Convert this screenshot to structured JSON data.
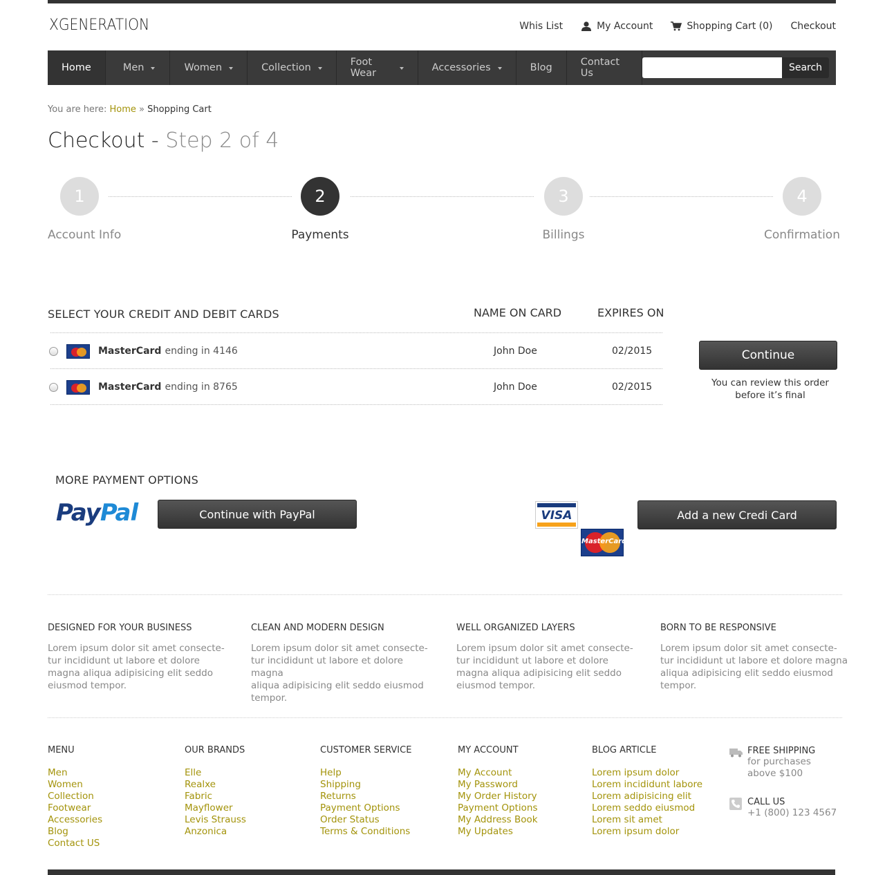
{
  "brand": {
    "logo": "XGENERATION"
  },
  "toplinks": {
    "wishlist": "Whis List",
    "account": "My Account",
    "cart": "Shopping Cart (0)",
    "checkout": "Checkout"
  },
  "nav": {
    "items": [
      "Home",
      "Men",
      "Women",
      "Collection",
      "Foot Wear",
      "Accessories",
      "Blog",
      "Contact Us"
    ],
    "search_placeholder": "",
    "search_button": "Search"
  },
  "breadcrumb": {
    "prefix": "You are here:",
    "home": "Home",
    "sep": "»",
    "current": "Shopping Cart"
  },
  "page": {
    "title": "Checkout",
    "dash": "-",
    "step_text": "Step 2 of 4"
  },
  "steps": [
    {
      "num": "1",
      "label": "Account Info"
    },
    {
      "num": "2",
      "label": "Payments"
    },
    {
      "num": "3",
      "label": "Billings"
    },
    {
      "num": "4",
      "label": "Confirmation"
    }
  ],
  "cards": {
    "heading": "SELECT YOUR CREDIT AND DEBIT CARDS",
    "col_name": "NAME ON CARD",
    "col_expires": "EXPIRES ON",
    "rows": [
      {
        "brand": "MasterCard",
        "ending": "ending in 4146",
        "name": "John Doe",
        "expires": "02/2015"
      },
      {
        "brand": "MasterCard",
        "ending": "ending in 8765",
        "name": "John Doe",
        "expires": "02/2015"
      }
    ],
    "continue_label": "Continue",
    "note_line1": "You can review this order",
    "note_line2": "before it’s final"
  },
  "more": {
    "heading": "MORE PAYMENT OPTIONS",
    "paypal_logo_a": "Pay",
    "paypal_logo_b": "Pal",
    "paypal_button": "Continue with PayPal",
    "visa_logo": "VISA",
    "mastercard_logo": "MasterCard",
    "add_card_button": "Add a new Credi Card"
  },
  "features": [
    {
      "title": "DESIGNED FOR YOUR BUSINESS",
      "l1": "Lorem ipsum dolor sit amet consecte-",
      "l2": "tur incididunt ut labore et dolore",
      "l3": "magna aliqua adipisicing elit seddo",
      "l4": "eiusmod tempor."
    },
    {
      "title": "CLEAN AND MODERN DESIGN",
      "l1": "Lorem ipsum dolor sit amet consecte-",
      "l2": "tur incididunt ut labore et dolore magna",
      "l3": "aliqua adipisicing elit seddo eiusmod",
      "l4": "tempor."
    },
    {
      "title": "WELL ORGANIZED LAYERS",
      "l1": "Lorem ipsum dolor sit amet consecte-",
      "l2": "tur incididunt ut labore et dolore",
      "l3": "magna aliqua adipisicing elit seddo",
      "l4": "eiusmod tempor."
    },
    {
      "title": "BORN TO BE RESPONSIVE",
      "l1": "Lorem ipsum dolor sit amet consecte-",
      "l2": "tur incididunt ut labore et dolore magna",
      "l3": "aliqua adipisicing elit seddo eiusmod",
      "l4": "tempor."
    }
  ],
  "footer": {
    "menu": {
      "title": "MENU",
      "links": [
        "Men",
        "Women",
        "Collection",
        "Footwear",
        "Accessories",
        "Blog",
        "Contact US"
      ]
    },
    "brands": {
      "title": "OUR BRANDS",
      "links": [
        "Elle",
        "Realxe",
        "Fabric",
        "Mayflower",
        "Levis Strauss",
        "Anzonica"
      ]
    },
    "service": {
      "title": "CUSTOMER SERVICE",
      "links": [
        "Help",
        "Shipping",
        "Returns",
        "Payment Options",
        "Order Status",
        "Terms & Conditions"
      ]
    },
    "account": {
      "title": "MY ACCOUNT",
      "links": [
        "My Account",
        "My Password",
        "My Order History",
        "Payment Options",
        "My Address Book",
        "My Updates"
      ]
    },
    "blog": {
      "title": "BLOG ARTICLE",
      "links": [
        "Lorem ipsum dolor",
        "Lorem incididunt labore",
        "Lorem adipisicing elit",
        "Lorem seddo eiusmod",
        "Lorem sit amet",
        "Lorem ipsum dolor"
      ]
    },
    "shipping": {
      "title": "FREE SHIPPING",
      "l1": "for purchases",
      "l2": "above $100"
    },
    "call": {
      "title": "CALL US",
      "phone": "+1 (800) 123 4567"
    }
  },
  "colors": {
    "accent_link": "#a3930a",
    "dark": "#333333",
    "nav_bg": "#3a3a3a"
  }
}
